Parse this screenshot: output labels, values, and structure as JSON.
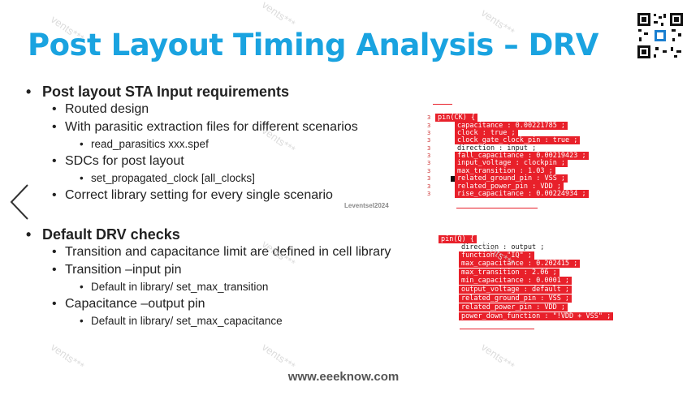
{
  "slide": {
    "title": "Post Layout Timing Analysis – DRV",
    "footer": "www.eeeknow.com",
    "credit": "Leventsel2024",
    "watermark": "vents***",
    "accent_color": "#1aa3e0",
    "highlight_color": "#e8202a"
  },
  "sections": [
    {
      "heading": "Post  layout STA Input requirements",
      "items": [
        {
          "text": "Routed design",
          "sub": []
        },
        {
          "text": "With parasitic extraction files for different scenarios",
          "sub": [
            "read_parasitics xxx.spef"
          ]
        },
        {
          "text": "SDCs for post layout",
          "sub": [
            "set_propagated_clock [all_clocks]"
          ]
        },
        {
          "text": "Correct library setting for every single scenario",
          "sub": []
        }
      ]
    },
    {
      "heading": "Default DRV checks",
      "items": [
        {
          "text": "Transition and capacitance limit are defined in cell library",
          "sub": []
        },
        {
          "text": "Transition –input pin",
          "sub": [
            "Default in library/ set_max_transition"
          ]
        },
        {
          "text": "Capacitance –output pin",
          "sub": [
            "Default in library/ set_max_capacitance"
          ]
        }
      ]
    }
  ],
  "code_input": {
    "lines": [
      {
        "n": "3",
        "text": "pin(CK) {",
        "hl": true
      },
      {
        "n": "3",
        "text": "capacitance : 0.00221785 ;",
        "hl": true
      },
      {
        "n": "3",
        "text": "clock : true ;",
        "hl": true
      },
      {
        "n": "3",
        "text": "clock_gate_clock_pin : true ;",
        "hl": true
      },
      {
        "n": "3",
        "text": "direction : input ;",
        "hl": false
      },
      {
        "n": "3",
        "text": "fall_capacitance : 0.00219423 ;",
        "hl": true
      },
      {
        "n": "3",
        "text": "input_voltage : clockpin ;",
        "hl": true
      },
      {
        "n": "3",
        "text": "max_transition : 1.03 ;",
        "hl": true
      },
      {
        "n": "3",
        "text": "related_ground_pin : VSS ;",
        "hl": true
      },
      {
        "n": "3",
        "text": "related_power_pin : VDD ;",
        "hl": true
      },
      {
        "n": "3",
        "text": "rise_capacitance : 0.00224934 ;",
        "hl": true
      }
    ]
  },
  "code_output": {
    "lines": [
      {
        "text": "pin(Q) {",
        "hl": true
      },
      {
        "text": "direction : output ;",
        "hl": false
      },
      {
        "text": "function : \"IQ\" ;",
        "hl": true
      },
      {
        "text": "max_capacitance : 0.202415 ;",
        "hl": true
      },
      {
        "text": "max_transition : 2.06 ;",
        "hl": true
      },
      {
        "text": "min_capacitance : 0.0001 ;",
        "hl": true
      },
      {
        "text": "output_voltage : default ;",
        "hl": true
      },
      {
        "text": "related_ground_pin : VSS ;",
        "hl": true
      },
      {
        "text": "related_power_pin : VDD ;",
        "hl": true
      },
      {
        "text": "power_down_function : \"!VDD + VSS\" ;",
        "hl": true
      }
    ]
  }
}
